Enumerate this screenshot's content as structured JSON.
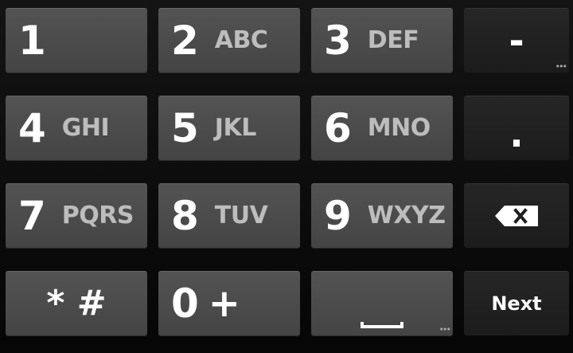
{
  "keys": {
    "k1": {
      "number": "1",
      "letters": ""
    },
    "k2": {
      "number": "2",
      "letters": "ABC"
    },
    "k3": {
      "number": "3",
      "letters": "DEF"
    },
    "k4": {
      "number": "4",
      "letters": "GHI"
    },
    "k5": {
      "number": "5",
      "letters": "JKL"
    },
    "k6": {
      "number": "6",
      "letters": "MNO"
    },
    "k7": {
      "number": "7",
      "letters": "PQRS"
    },
    "k8": {
      "number": "8",
      "letters": "TUV"
    },
    "k9": {
      "number": "9",
      "letters": "WXYZ"
    },
    "k0": {
      "number": "0",
      "letters": "+"
    },
    "star_hash": "* #",
    "minus": "-",
    "period": ".",
    "next": "Next"
  },
  "icons": {
    "backspace": "backspace-icon",
    "space": "space-icon",
    "more": "more-ellipsis-icon"
  }
}
